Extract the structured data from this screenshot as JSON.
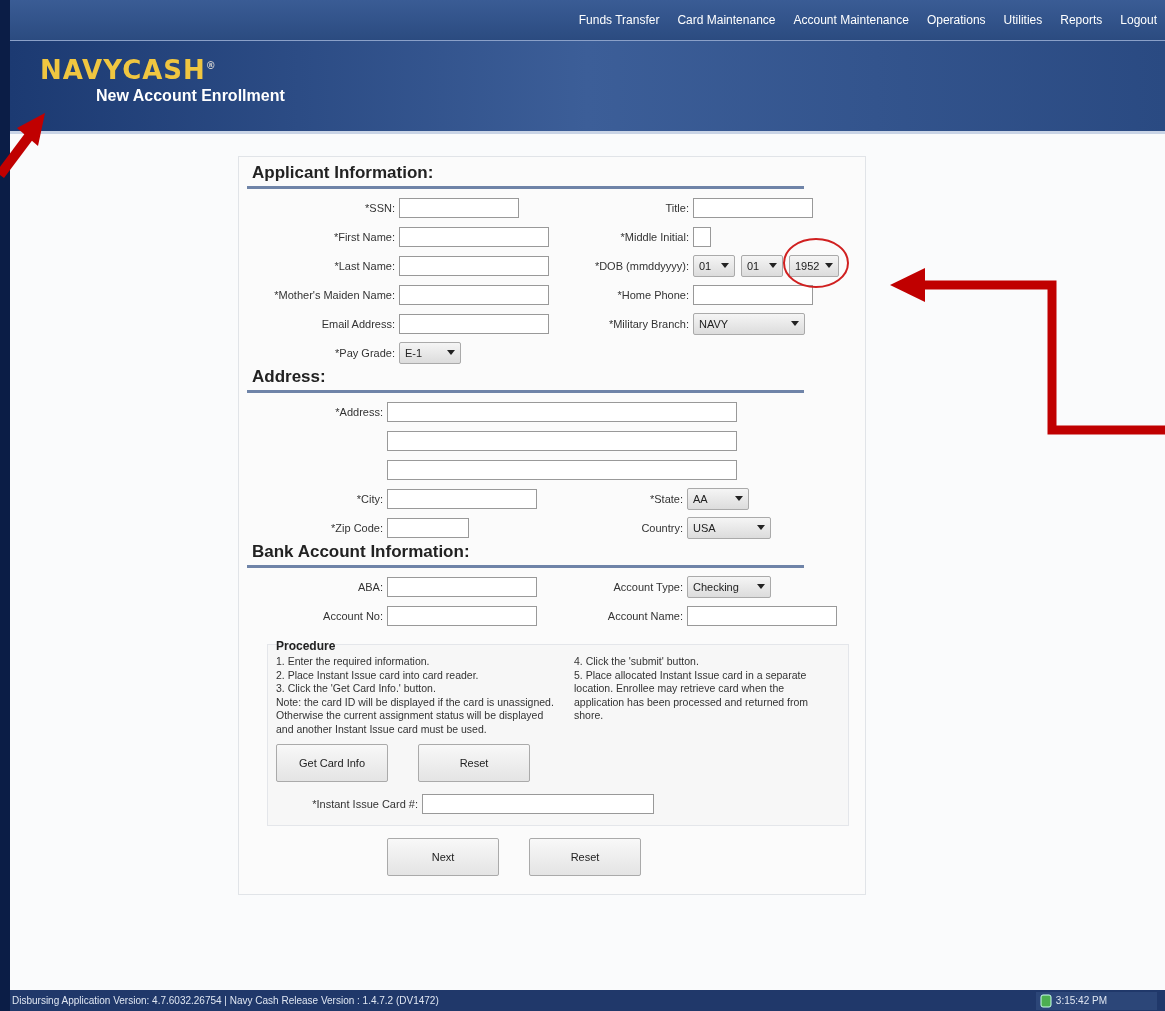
{
  "nav": {
    "items": [
      "Funds Transfer",
      "Card Maintenance",
      "Account Maintenance",
      "Operations",
      "Utilities",
      "Reports",
      "Logout"
    ]
  },
  "header": {
    "logo": "NAVYCASH$^{®}$",
    "page_title": "New Account Enrollment"
  },
  "sections": [
    {
      "title": "Applicant Information:",
      "kind": "pairs",
      "rows": [
        {
          "left": {
            "label": "*SSN:",
            "kind": "text"
          },
          "right": {
            "label": "Title:",
            "kind": "text"
          }
        },
        {
          "left": {
            "label": "*First Name:",
            "kind": "text"
          },
          "right": {
            "label": "*Middle Initial:",
            "kind": "text"
          }
        },
        {
          "left": {
            "label": "*Last Name:",
            "kind": "text"
          },
          "right": {
            "label": "*DOB (mmddyyyy):",
            "kind": "date",
            "parts": [
              "01",
              "01",
              "1952"
            ]
          }
        },
        {
          "left": {
            "label": "*Mother's Maiden Name:",
            "kind": "text"
          },
          "right": {
            "label": "*Home Phone:",
            "kind": "text"
          }
        },
        {
          "left": {
            "label": "Email Address:",
            "kind": "text"
          },
          "right": {
            "label": "*Military Branch:",
            "kind": "select",
            "value": "NAVY"
          }
        },
        {
          "left": {
            "label": "*Pay Grade:",
            "kind": "select",
            "value": "E-1"
          }
        }
      ]
    },
    {
      "title": "Address:",
      "kind": "address",
      "rows": [
        {
          "left": {
            "label": "*Address:",
            "kind": "text"
          }
        },
        {
          "left": {
            "kind": "text"
          }
        },
        {
          "left": {
            "kind": "text"
          }
        },
        {
          "left": {
            "label": "*City:",
            "kind": "text"
          },
          "right": {
            "label": "*State:",
            "kind": "select",
            "value": "AA"
          }
        },
        {
          "left": {
            "label": "*Zip Code:",
            "kind": "text"
          },
          "right": {
            "label": "Country:",
            "kind": "select",
            "value": "USA"
          }
        }
      ]
    },
    {
      "title": "Bank Account Information:",
      "kind": "address",
      "rows": [
        {
          "left": {
            "label": "ABA:",
            "kind": "text"
          },
          "right": {
            "label": "Account Type:",
            "kind": "select",
            "value": "Checking"
          }
        },
        {
          "left": {
            "label": "Account No:",
            "kind": "text"
          },
          "right": {
            "label": "Account Name:",
            "kind": "text"
          }
        }
      ]
    }
  ],
  "procedure": {
    "title": "Procedure",
    "left_text": [
      "1. Enter the required information.",
      "2. Place Instant Issue card into card reader.",
      "3. Click the 'Get Card Info.' button.",
      "Note: the card ID will be displayed if the card is unassigned. Otherwise the current assignment status will be displayed and another Instant Issue card must be used."
    ],
    "right_text": [
      "4. Click the 'submit' button.",
      "5. Place allocated Instant Issue card in a separate location. Enrollee may retrieve card when the application has been processed and returned from shore."
    ],
    "buttons": [
      "Get Card Info",
      "Reset"
    ],
    "card_label": "*Instant Issue Card #:"
  },
  "buttons": [
    "Next",
    "Reset"
  ],
  "status_bar": {
    "version": "Disbursing Application Version:  4.7.6032.26754  | Navy Cash Release Version : 1.4.7.2 (DV1472)",
    "time": "3:15:42 PM"
  }
}
